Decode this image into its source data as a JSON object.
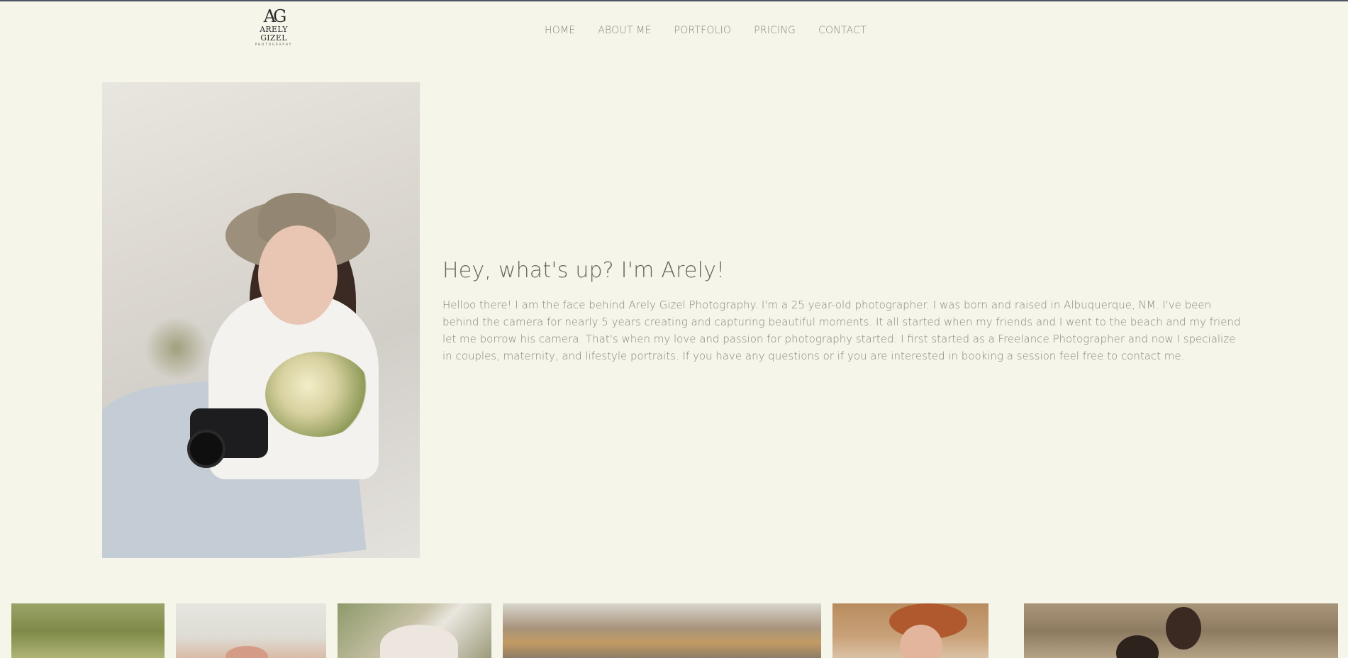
{
  "header": {
    "logo": {
      "monogram": "AG",
      "name": "ARELY GIZEL",
      "tagline": "PHOTOGRAPHY"
    },
    "nav": [
      {
        "label": "HOME"
      },
      {
        "label": "ABOUT ME"
      },
      {
        "label": "PORTFOLIO"
      },
      {
        "label": "PRICING"
      },
      {
        "label": "CONTACT"
      }
    ]
  },
  "about": {
    "headline": "Hey, what's up? I'm Arely!",
    "bio": "Helloo there! I am the face behind Arely Gizel Photography. I'm a 25 year-old photographer. I was born and raised in Albuquerque, NM. I've been behind the camera for nearly 5 years creating and capturing beautiful moments. It all started when my friends and I went to the beach and my friend let me borrow his camera. That's when my love and passion for photography started. I first started as a Freelance Photographer and now I specialize in couples, maternity, and lifestyle portraits. If you have any questions or if you are interested in booking a session feel free to contact me."
  },
  "colors": {
    "background": "#f5f5ea",
    "text": "#8a8480",
    "headline": "#6a6460",
    "topbar": "#4c5560"
  }
}
